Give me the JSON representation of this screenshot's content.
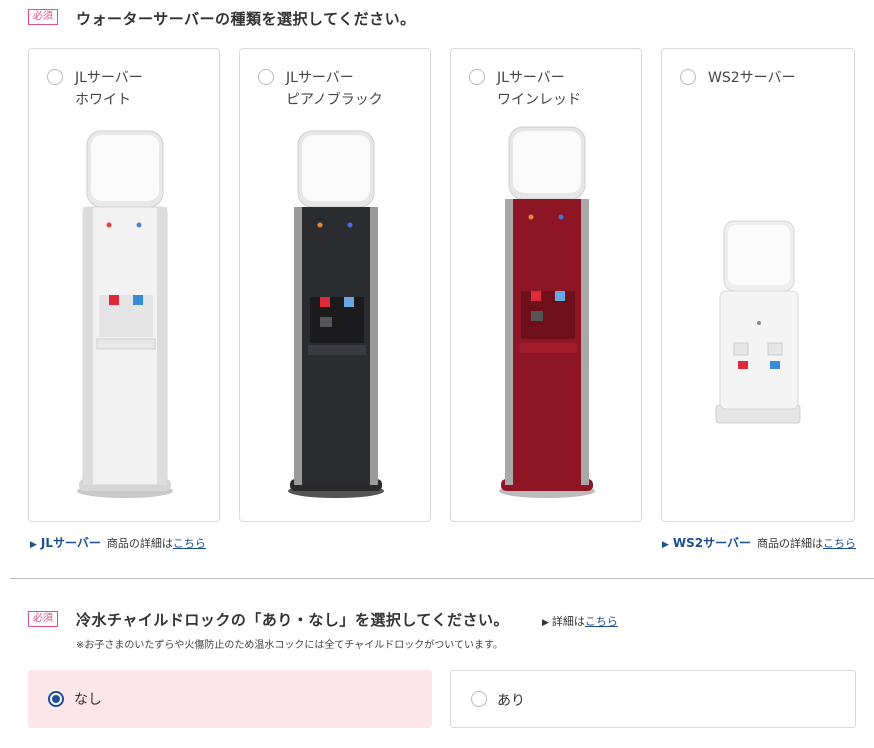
{
  "section1": {
    "required_badge": "必須",
    "heading": "ウォーターサーバーの種類を選択してください。",
    "options": [
      {
        "line1": "JLサーバー",
        "line2": "ホワイト",
        "body": "#f2f2f2",
        "accent": "#dcdcdc",
        "selected": false
      },
      {
        "line1": "JLサーバー",
        "line2": "ピアノブラック",
        "body": "#2b2c30",
        "accent": "#4a4b50",
        "selected": false
      },
      {
        "line1": "JLサーバー",
        "line2": "ワインレッド",
        "body": "#8e1524",
        "accent": "#b12233",
        "selected": false
      },
      {
        "line1": "WS2サーバー",
        "line2": "",
        "body": "#f4f4f4",
        "accent": "#e0e0e0",
        "selected": false
      }
    ],
    "links": [
      {
        "name": "JLサーバー",
        "text": "商品の詳細は",
        "link": "こちら"
      },
      {
        "name": "WS2サーバー",
        "text": "商品の詳細は",
        "link": "こちら"
      }
    ]
  },
  "section2": {
    "required_badge": "必須",
    "heading": "冷水チャイルドロックの「あり・なし」を選択してください。",
    "detail_text": "詳細は",
    "detail_link": "こちら",
    "note": "※お子さまのいたずらや火傷防止のため温水コックには全てチャイルドロックがついています。",
    "options": [
      {
        "label": "なし",
        "selected": true
      },
      {
        "label": "あり",
        "selected": false
      }
    ]
  },
  "colors": {
    "accent": "#1d4f91",
    "badge": "#e0508a",
    "selected_bg": "#fde6ea"
  }
}
